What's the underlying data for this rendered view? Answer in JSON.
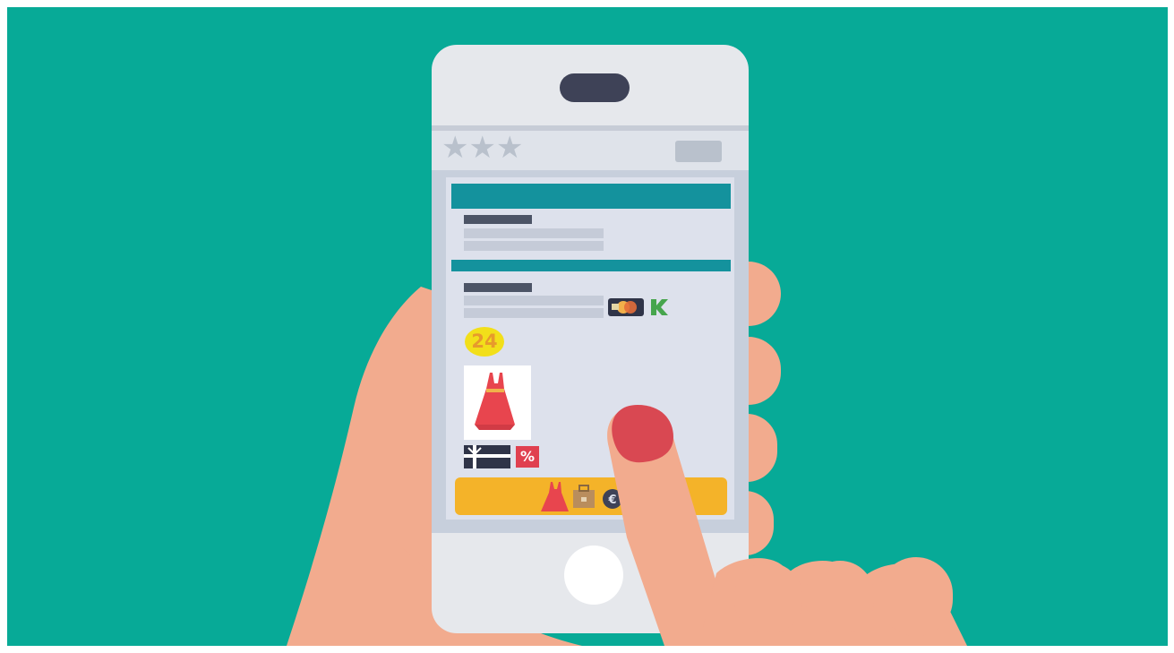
{
  "colors": {
    "background": "#07aa97",
    "phone_body": "#e6e8ec",
    "screen": "#dde1ec",
    "header_bar": "#14929d",
    "checkout_bar": "#f4b329",
    "skin": "#f2ab8e",
    "nail": "#d94852",
    "dress": "#e8454e"
  },
  "icons": {
    "rating": [
      "star-icon",
      "star-icon",
      "star-icon"
    ],
    "payment": [
      "credit-card-icon",
      "kash-logo-icon"
    ],
    "product": "dress-icon",
    "checkout": [
      "dress-icon",
      "briefcase-icon",
      "euro-coin-icon"
    ],
    "promo": [
      "gift-card-icon",
      "percent-icon"
    ]
  },
  "badge": {
    "text": "24"
  },
  "promo": {
    "percent_symbol": "%"
  },
  "rating": {
    "stars": 3
  }
}
